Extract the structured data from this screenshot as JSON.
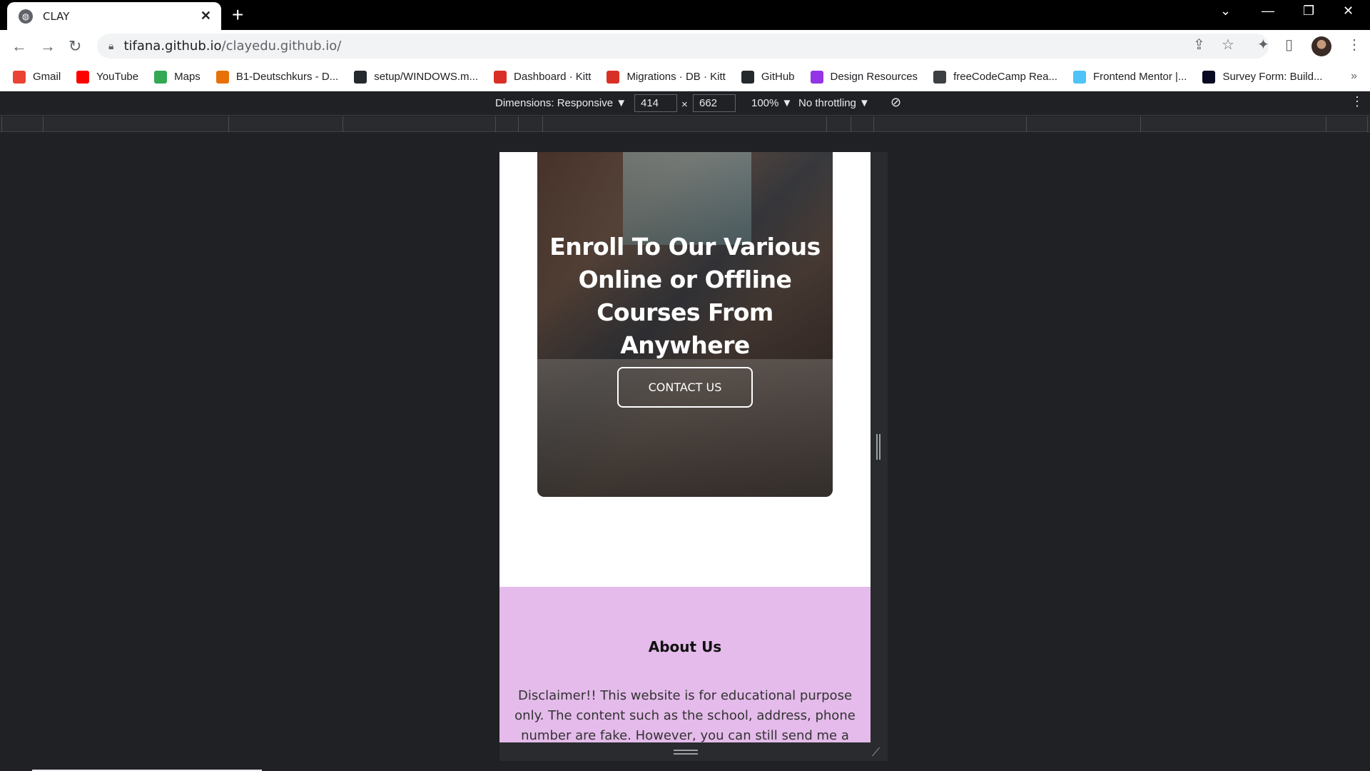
{
  "browser": {
    "tab_title": "CLAY",
    "url_host": "tifana.github.io",
    "url_path": "/clayedu.github.io/"
  },
  "bookmarks": [
    {
      "label": "Gmail",
      "color": "#ea4335",
      "icon": "gmail-icon"
    },
    {
      "label": "YouTube",
      "color": "#ff0000",
      "icon": "youtube-icon"
    },
    {
      "label": "Maps",
      "color": "#34a853",
      "icon": "maps-icon"
    },
    {
      "label": "B1-Deutschkurs - D...",
      "color": "#e8710a",
      "icon": "deutschkurs-icon"
    },
    {
      "label": "setup/WINDOWS.m...",
      "color": "#24292e",
      "icon": "github-icon"
    },
    {
      "label": "Dashboard · Kitt",
      "color": "#d93025",
      "icon": "kitt-icon"
    },
    {
      "label": "Migrations · DB · Kitt",
      "color": "#d93025",
      "icon": "kitt-icon"
    },
    {
      "label": "GitHub",
      "color": "#24292e",
      "icon": "github-icon"
    },
    {
      "label": "Design Resources",
      "color": "#9334e6",
      "icon": "design-icon"
    },
    {
      "label": "freeCodeCamp Rea...",
      "color": "#3c4043",
      "icon": "freecodecamp-icon"
    },
    {
      "label": "Frontend Mentor |...",
      "color": "#4fc3f7",
      "icon": "frontendmentor-icon"
    },
    {
      "label": "Survey Form: Build...",
      "color": "#0a0a23",
      "icon": "survey-icon"
    }
  ],
  "devtools": {
    "dimensions_label": "Dimensions: Responsive ▼",
    "width": "414",
    "times": "×",
    "height": "662",
    "zoom": "100% ▼",
    "throttling": "No throttling ▼"
  },
  "page": {
    "hero_heading": "Enroll To Our Various Online or Offline Courses From Anywhere",
    "cta_label": "CONTACT US",
    "about_heading": "About Us",
    "about_text": "Disclaimer!! This website is for educational purpose only. The content such as the school, address, phone number are fake. However, you can still send me a message"
  }
}
